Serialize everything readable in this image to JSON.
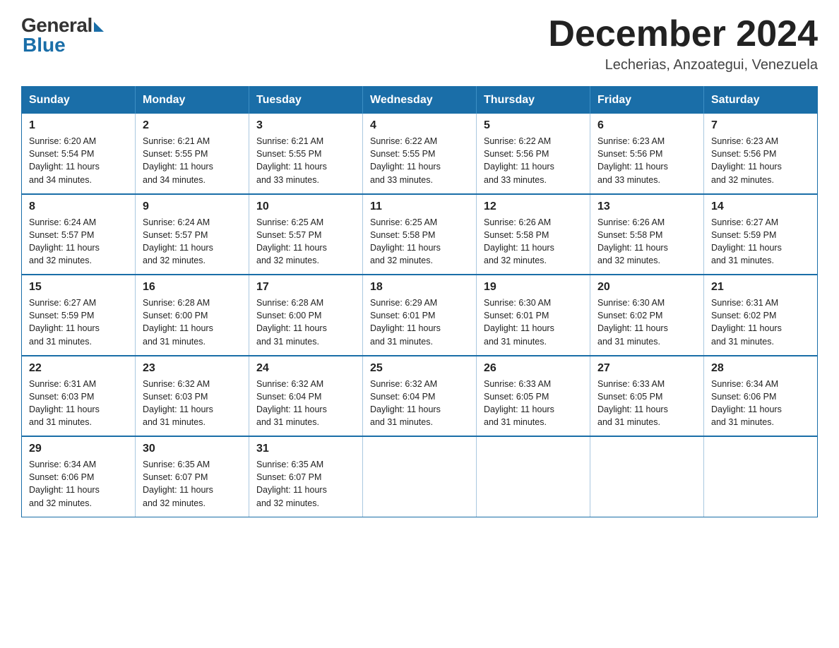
{
  "logo": {
    "general": "General",
    "blue": "Blue"
  },
  "title": {
    "month_year": "December 2024",
    "location": "Lecherias, Anzoategui, Venezuela"
  },
  "headers": [
    "Sunday",
    "Monday",
    "Tuesday",
    "Wednesday",
    "Thursday",
    "Friday",
    "Saturday"
  ],
  "weeks": [
    [
      {
        "day": "1",
        "sunrise": "6:20 AM",
        "sunset": "5:54 PM",
        "daylight": "11 hours and 34 minutes."
      },
      {
        "day": "2",
        "sunrise": "6:21 AM",
        "sunset": "5:55 PM",
        "daylight": "11 hours and 34 minutes."
      },
      {
        "day": "3",
        "sunrise": "6:21 AM",
        "sunset": "5:55 PM",
        "daylight": "11 hours and 33 minutes."
      },
      {
        "day": "4",
        "sunrise": "6:22 AM",
        "sunset": "5:55 PM",
        "daylight": "11 hours and 33 minutes."
      },
      {
        "day": "5",
        "sunrise": "6:22 AM",
        "sunset": "5:56 PM",
        "daylight": "11 hours and 33 minutes."
      },
      {
        "day": "6",
        "sunrise": "6:23 AM",
        "sunset": "5:56 PM",
        "daylight": "11 hours and 33 minutes."
      },
      {
        "day": "7",
        "sunrise": "6:23 AM",
        "sunset": "5:56 PM",
        "daylight": "11 hours and 32 minutes."
      }
    ],
    [
      {
        "day": "8",
        "sunrise": "6:24 AM",
        "sunset": "5:57 PM",
        "daylight": "11 hours and 32 minutes."
      },
      {
        "day": "9",
        "sunrise": "6:24 AM",
        "sunset": "5:57 PM",
        "daylight": "11 hours and 32 minutes."
      },
      {
        "day": "10",
        "sunrise": "6:25 AM",
        "sunset": "5:57 PM",
        "daylight": "11 hours and 32 minutes."
      },
      {
        "day": "11",
        "sunrise": "6:25 AM",
        "sunset": "5:58 PM",
        "daylight": "11 hours and 32 minutes."
      },
      {
        "day": "12",
        "sunrise": "6:26 AM",
        "sunset": "5:58 PM",
        "daylight": "11 hours and 32 minutes."
      },
      {
        "day": "13",
        "sunrise": "6:26 AM",
        "sunset": "5:58 PM",
        "daylight": "11 hours and 32 minutes."
      },
      {
        "day": "14",
        "sunrise": "6:27 AM",
        "sunset": "5:59 PM",
        "daylight": "11 hours and 31 minutes."
      }
    ],
    [
      {
        "day": "15",
        "sunrise": "6:27 AM",
        "sunset": "5:59 PM",
        "daylight": "11 hours and 31 minutes."
      },
      {
        "day": "16",
        "sunrise": "6:28 AM",
        "sunset": "6:00 PM",
        "daylight": "11 hours and 31 minutes."
      },
      {
        "day": "17",
        "sunrise": "6:28 AM",
        "sunset": "6:00 PM",
        "daylight": "11 hours and 31 minutes."
      },
      {
        "day": "18",
        "sunrise": "6:29 AM",
        "sunset": "6:01 PM",
        "daylight": "11 hours and 31 minutes."
      },
      {
        "day": "19",
        "sunrise": "6:30 AM",
        "sunset": "6:01 PM",
        "daylight": "11 hours and 31 minutes."
      },
      {
        "day": "20",
        "sunrise": "6:30 AM",
        "sunset": "6:02 PM",
        "daylight": "11 hours and 31 minutes."
      },
      {
        "day": "21",
        "sunrise": "6:31 AM",
        "sunset": "6:02 PM",
        "daylight": "11 hours and 31 minutes."
      }
    ],
    [
      {
        "day": "22",
        "sunrise": "6:31 AM",
        "sunset": "6:03 PM",
        "daylight": "11 hours and 31 minutes."
      },
      {
        "day": "23",
        "sunrise": "6:32 AM",
        "sunset": "6:03 PM",
        "daylight": "11 hours and 31 minutes."
      },
      {
        "day": "24",
        "sunrise": "6:32 AM",
        "sunset": "6:04 PM",
        "daylight": "11 hours and 31 minutes."
      },
      {
        "day": "25",
        "sunrise": "6:32 AM",
        "sunset": "6:04 PM",
        "daylight": "11 hours and 31 minutes."
      },
      {
        "day": "26",
        "sunrise": "6:33 AM",
        "sunset": "6:05 PM",
        "daylight": "11 hours and 31 minutes."
      },
      {
        "day": "27",
        "sunrise": "6:33 AM",
        "sunset": "6:05 PM",
        "daylight": "11 hours and 31 minutes."
      },
      {
        "day": "28",
        "sunrise": "6:34 AM",
        "sunset": "6:06 PM",
        "daylight": "11 hours and 31 minutes."
      }
    ],
    [
      {
        "day": "29",
        "sunrise": "6:34 AM",
        "sunset": "6:06 PM",
        "daylight": "11 hours and 32 minutes."
      },
      {
        "day": "30",
        "sunrise": "6:35 AM",
        "sunset": "6:07 PM",
        "daylight": "11 hours and 32 minutes."
      },
      {
        "day": "31",
        "sunrise": "6:35 AM",
        "sunset": "6:07 PM",
        "daylight": "11 hours and 32 minutes."
      },
      null,
      null,
      null,
      null
    ]
  ],
  "labels": {
    "sunrise": "Sunrise:",
    "sunset": "Sunset:",
    "daylight": "Daylight:"
  }
}
